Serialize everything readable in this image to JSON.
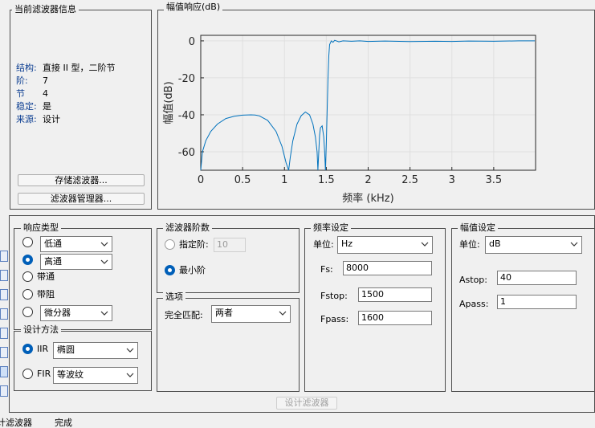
{
  "filter_info": {
    "title": "当前滤波器信息",
    "rows": [
      {
        "key": "结构:",
        "value": "直接 II 型，二阶节"
      },
      {
        "key": "阶:",
        "value": "7"
      },
      {
        "key": "节",
        "value": "4"
      },
      {
        "key": "稳定:",
        "value": "是"
      },
      {
        "key": "来源:",
        "value": "设计"
      }
    ],
    "store_button": "存储滤波器...",
    "manager_button": "滤波器管理器..."
  },
  "plot": {
    "title": "幅值响应(dB)",
    "ylabel": "幅值(dB)",
    "xlabel": "频率 (kHz)"
  },
  "chart_data": {
    "type": "line",
    "title": "",
    "xlabel": "频率 (kHz)",
    "ylabel": "幅值(dB)",
    "xlim": [
      0,
      4
    ],
    "ylim": [
      -70,
      3
    ],
    "xticks": [
      0,
      0.5,
      1,
      1.5,
      2,
      2.5,
      3,
      3.5
    ],
    "xtick_labels": [
      "0",
      "0.5",
      "1",
      "1.5",
      "2",
      "2.5",
      "3",
      "3.5"
    ],
    "yticks": [
      0,
      -20,
      -40,
      -60
    ],
    "ytick_labels": [
      "0",
      "-20",
      "-40",
      "-60"
    ],
    "grid": true,
    "color": "#0072bd",
    "x": [
      0,
      0.02,
      0.06,
      0.12,
      0.2,
      0.3,
      0.4,
      0.5,
      0.6,
      0.65,
      0.7,
      0.8,
      0.9,
      0.97,
      1.02,
      1.05,
      1.07,
      1.1,
      1.15,
      1.2,
      1.25,
      1.3,
      1.34,
      1.37,
      1.39,
      1.4,
      1.41,
      1.42,
      1.43,
      1.45,
      1.47,
      1.48,
      1.49,
      1.5,
      1.51,
      1.52,
      1.53,
      1.54,
      1.56,
      1.58,
      1.6,
      1.65,
      1.7,
      1.8,
      1.9,
      2.0,
      2.2,
      2.5,
      2.8,
      3.0,
      3.2,
      3.5,
      3.8,
      3.99
    ],
    "y": [
      -70,
      -60,
      -54,
      -49,
      -45,
      -42,
      -40.8,
      -40.2,
      -40,
      -40.1,
      -40.6,
      -43,
      -49,
      -57,
      -66,
      -70,
      -63,
      -54,
      -45,
      -40.5,
      -38.5,
      -40,
      -45,
      -52,
      -60,
      -70,
      -60,
      -51,
      -47,
      -46,
      -52,
      -60,
      -70,
      -55,
      -38,
      -20,
      -8,
      -2,
      0,
      -0.8,
      0.3,
      -0.5,
      0,
      -0.2,
      0,
      -0.3,
      -0.1,
      -0.4,
      -0.2,
      -0.3,
      -0.1,
      -0.2,
      0,
      0
    ]
  },
  "response_type": {
    "title": "响应类型",
    "options": [
      {
        "label": "低通",
        "has_dropdown": true,
        "selected": false
      },
      {
        "label": "高通",
        "has_dropdown": true,
        "selected": true
      },
      {
        "label": "带通",
        "has_dropdown": false,
        "selected": false
      },
      {
        "label": "带阻",
        "has_dropdown": false,
        "selected": false
      },
      {
        "label": "微分器",
        "has_dropdown": true,
        "selected": false
      }
    ]
  },
  "design_method": {
    "title": "设计方法",
    "iir_label": "IIR",
    "iir_value": "椭圆",
    "fir_label": "FIR",
    "fir_value": "等波纹",
    "selected": "IIR"
  },
  "filter_order": {
    "title": "滤波器阶数",
    "specify_label": "指定阶:",
    "specify_value": "10",
    "minimum_label": "最小阶"
  },
  "options": {
    "title": "选项",
    "match_label": "完全匹配:",
    "match_value": "两者"
  },
  "freq_spec": {
    "title": "频率设定",
    "unit_label": "单位:",
    "unit_value": "Hz",
    "fs_label": "Fs:",
    "fs_value": "8000",
    "fstop_label": "Fstop:",
    "fstop_value": "1500",
    "fpass_label": "Fpass:",
    "fpass_value": "1600"
  },
  "mag_spec": {
    "title": "幅值设定",
    "unit_label": "单位:",
    "unit_value": "dB",
    "astop_label": "Astop:",
    "astop_value": "40",
    "apass_label": "Apass:",
    "apass_value": "1"
  },
  "design_button": "设计滤波器",
  "status": {
    "left": "计滤波器",
    "right": "完成"
  }
}
